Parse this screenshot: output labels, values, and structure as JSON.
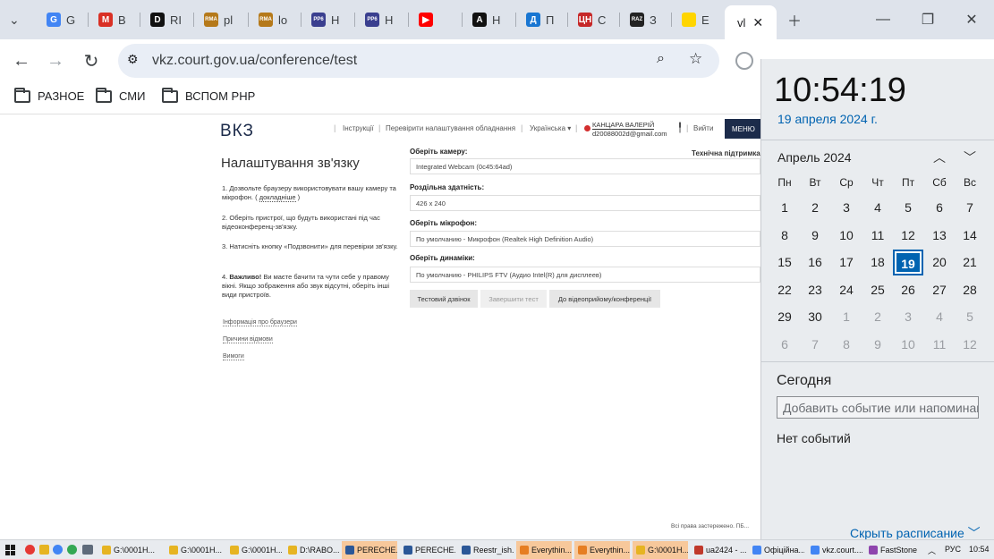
{
  "tabs": [
    {
      "label": "G",
      "icon": "google-icon",
      "color": "#4285f4",
      "glyph": "G"
    },
    {
      "label": "B",
      "icon": "gmail-icon",
      "color": "#d93025",
      "glyph": "M"
    },
    {
      "label": "RI",
      "icon": "d-letter-icon",
      "color": "#111111",
      "glyph": "D"
    },
    {
      "label": "pl",
      "icon": "rma-icon",
      "color": "#b5791a",
      "glyph": "RMA"
    },
    {
      "label": "lo",
      "icon": "rma-icon",
      "color": "#b5791a",
      "glyph": "RMA"
    },
    {
      "label": "H",
      "icon": "pp-icon",
      "color": "#3a3f8f",
      "glyph": "PP6"
    },
    {
      "label": "H",
      "icon": "pp-icon",
      "color": "#3a3f8f",
      "glyph": "PP6"
    },
    {
      "label": "",
      "icon": "youtube-icon",
      "color": "#ff0000",
      "glyph": "▶"
    },
    {
      "label": "H",
      "icon": "a-letter-icon",
      "color": "#111111",
      "glyph": "A"
    },
    {
      "label": "П",
      "icon": "d-blue-icon",
      "color": "#1976d2",
      "glyph": "Д"
    },
    {
      "label": "С",
      "icon": "cn-icon",
      "color": "#c62828",
      "glyph": "ЦН"
    },
    {
      "label": "З",
      "icon": "raz-icon",
      "color": "#222222",
      "glyph": "RAZ"
    },
    {
      "label": "Е",
      "icon": "ukraine-flag-icon",
      "color": "#ffd500",
      "glyph": ""
    }
  ],
  "active_tab": {
    "label": "vl",
    "icon": "vkz-favicon"
  },
  "url": "vkz.court.gov.ua/conference/test",
  "bookmarks": [
    "РАЗНОЕ",
    "СМИ",
    "ВСПОМ РНР"
  ],
  "site": {
    "logo": "ВКЗ",
    "nav": [
      "Інструкції",
      "Перевірити налаштування обладнання",
      "Українська ▾"
    ],
    "user_name": "КАНЦАРА ВАЛЕРІЙ",
    "user_email": "d20088002d@gmail.com",
    "logout": "Вийти",
    "menu": "МЕНЮ",
    "tech_support": "Технічна підтримка",
    "title": "Налаштування зв'язку",
    "steps": [
      {
        "text": "Дозвольте браузеру використовувати вашу камеру та мікрофон. ( ",
        "link": "докладніше",
        "tail": " )"
      },
      {
        "text": "Оберіть пристрої, що будуть використані під час відеоконференц-зв'язку."
      },
      {
        "text": "Натисніть кнопку «Подзвонити» для перевірки зв'язку."
      },
      {
        "bold": "Важливо!",
        "text": " Ви маєте бачити та чути себе у правому вікні. Якщо зображення або звук відсутні, оберіть інші види пристроїв."
      }
    ],
    "side_links": [
      "Інформація про браузери",
      "Причини відмови",
      "Вимоги"
    ],
    "camera_label": "Оберіть камеру:",
    "camera_value": "Integrated Webcam (0c45:64ad)",
    "resolution_label": "Роздільна здатність:",
    "resolution_value": "426 x 240",
    "mic_label": "Оберіть мікрофон:",
    "mic_value": "По умолчанию - Микрофон (Realtek High Definition Audio)",
    "speakers_label": "Оберіть динаміки:",
    "speakers_value": "По умолчанию - PHILIPS FTV (Аудио Intel(R) для дисплеев)",
    "btn_test_call": "Тестовий дзвінок",
    "btn_end_test": "Завершити тест",
    "btn_to_conf": "До відеоприйому/конференції",
    "rights": "Всі права застережено. ПБ..."
  },
  "calendar": {
    "time": "10:54:19",
    "date": "19 апреля 2024 г.",
    "month": "Апрель 2024",
    "weekdays": [
      "Пн",
      "Вт",
      "Ср",
      "Чт",
      "Пт",
      "Сб",
      "Вс"
    ],
    "weeks": [
      [
        "1",
        "2",
        "3",
        "4",
        "5",
        "6",
        "7"
      ],
      [
        "8",
        "9",
        "10",
        "11",
        "12",
        "13",
        "14"
      ],
      [
        "15",
        "16",
        "17",
        "18",
        "19",
        "20",
        "21"
      ],
      [
        "22",
        "23",
        "24",
        "25",
        "26",
        "27",
        "28"
      ],
      [
        "29",
        "30",
        "1",
        "2",
        "3",
        "4",
        "5"
      ],
      [
        "6",
        "7",
        "8",
        "9",
        "10",
        "11",
        "12"
      ]
    ],
    "today_label": "Сегодня",
    "event_placeholder": "Добавить событие или напоминание",
    "no_events": "Нет событий",
    "hide_schedule": "Скрыть расписание"
  },
  "taskbar": {
    "items": [
      {
        "label": "G:\\0001Н...",
        "color": "#e6b422"
      },
      {
        "label": "G:\\0001Н...",
        "color": "#e6b422"
      },
      {
        "label": "G:\\0001Н...",
        "color": "#e6b422"
      },
      {
        "label": "D:\\RABO...",
        "color": "#e6b422"
      },
      {
        "label": "PERECHE...",
        "color": "#2b5797",
        "hl": true
      },
      {
        "label": "PERECHE...",
        "color": "#2b5797"
      },
      {
        "label": "Reestr_ish...",
        "color": "#2b5797"
      },
      {
        "label": "Everythin...",
        "color": "#e67e22",
        "hl": true
      },
      {
        "label": "Everythin...",
        "color": "#e67e22",
        "hl": true
      },
      {
        "label": "G:\\0001Н...",
        "color": "#e6b422",
        "hl": true
      },
      {
        "label": "ua2424 - ...",
        "color": "#c0392b"
      },
      {
        "label": "Офіційна...",
        "color": "#4285f4"
      },
      {
        "label": "vkz.court....",
        "color": "#4285f4"
      },
      {
        "label": "FastStone",
        "color": "#8e44ad"
      }
    ],
    "lang": "РУС",
    "time": "10:54"
  }
}
